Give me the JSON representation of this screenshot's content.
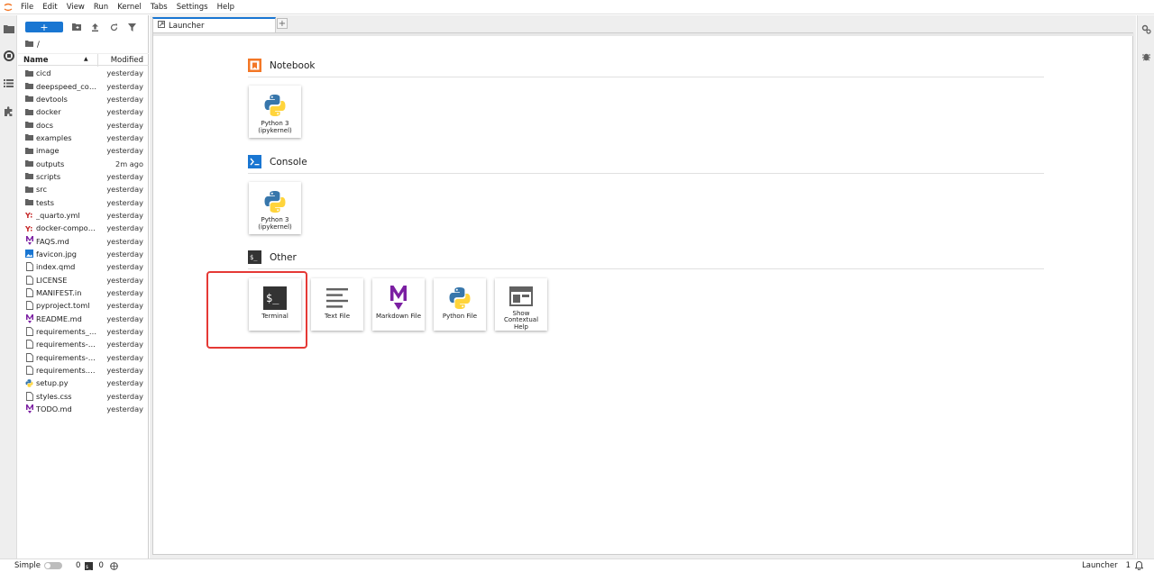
{
  "menu": [
    "File",
    "Edit",
    "View",
    "Run",
    "Kernel",
    "Tabs",
    "Settings",
    "Help"
  ],
  "filebrowser": {
    "new_label": "+",
    "breadcrumb": "/",
    "col_name": "Name",
    "col_modified": "Modified",
    "files": [
      {
        "name": "cicd",
        "modified": "yesterday",
        "type": "folder"
      },
      {
        "name": "deepspeed_conf...",
        "modified": "yesterday",
        "type": "folder"
      },
      {
        "name": "devtools",
        "modified": "yesterday",
        "type": "folder"
      },
      {
        "name": "docker",
        "modified": "yesterday",
        "type": "folder"
      },
      {
        "name": "docs",
        "modified": "yesterday",
        "type": "folder"
      },
      {
        "name": "examples",
        "modified": "yesterday",
        "type": "folder"
      },
      {
        "name": "image",
        "modified": "yesterday",
        "type": "folder"
      },
      {
        "name": "outputs",
        "modified": "2m ago",
        "type": "folder"
      },
      {
        "name": "scripts",
        "modified": "yesterday",
        "type": "folder"
      },
      {
        "name": "src",
        "modified": "yesterday",
        "type": "folder"
      },
      {
        "name": "tests",
        "modified": "yesterday",
        "type": "folder"
      },
      {
        "name": "_quarto.yml",
        "modified": "yesterday",
        "type": "yaml"
      },
      {
        "name": "docker-compose...",
        "modified": "yesterday",
        "type": "yaml"
      },
      {
        "name": "FAQS.md",
        "modified": "yesterday",
        "type": "markdown"
      },
      {
        "name": "favicon.jpg",
        "modified": "yesterday",
        "type": "image"
      },
      {
        "name": "index.qmd",
        "modified": "yesterday",
        "type": "file"
      },
      {
        "name": "LICENSE",
        "modified": "yesterday",
        "type": "file"
      },
      {
        "name": "MANIFEST.in",
        "modified": "yesterday",
        "type": "file"
      },
      {
        "name": "pyproject.toml",
        "modified": "yesterday",
        "type": "file"
      },
      {
        "name": "README.md",
        "modified": "yesterday",
        "type": "markdown"
      },
      {
        "name": "requirements_en...",
        "modified": "yesterday",
        "type": "file"
      },
      {
        "name": "requirements-de...",
        "modified": "yesterday",
        "type": "file"
      },
      {
        "name": "requirements-te...",
        "modified": "yesterday",
        "type": "file"
      },
      {
        "name": "requirements.txt",
        "modified": "yesterday",
        "type": "file"
      },
      {
        "name": "setup.py",
        "modified": "yesterday",
        "type": "python"
      },
      {
        "name": "styles.css",
        "modified": "yesterday",
        "type": "file"
      },
      {
        "name": "TODO.md",
        "modified": "yesterday",
        "type": "markdown"
      }
    ]
  },
  "tab": {
    "label": "Launcher",
    "add_label": "+"
  },
  "launcher": {
    "notebook": {
      "title": "Notebook",
      "cards": [
        {
          "label": "Python 3\n(ipykernel)"
        }
      ]
    },
    "console": {
      "title": "Console",
      "cards": [
        {
          "label": "Python 3\n(ipykernel)"
        }
      ]
    },
    "other": {
      "title": "Other",
      "cards": [
        {
          "label": "Terminal",
          "icon": "terminal-icon"
        },
        {
          "label": "Text File",
          "icon": "text-file-icon"
        },
        {
          "label": "Markdown File",
          "icon": "markdown-icon"
        },
        {
          "label": "Python File",
          "icon": "python-icon"
        },
        {
          "label": "Show\nContextual\nHelp",
          "icon": "contextual-help-icon"
        }
      ]
    }
  },
  "status": {
    "mode": "Simple",
    "kernels": "0",
    "terminals": "0",
    "right": "Launcher",
    "count": "1"
  },
  "colors": {
    "accent": "#1976d2",
    "highlight": "#e53935",
    "notebook": "#f37726",
    "markdown": "#7b1fa2"
  }
}
